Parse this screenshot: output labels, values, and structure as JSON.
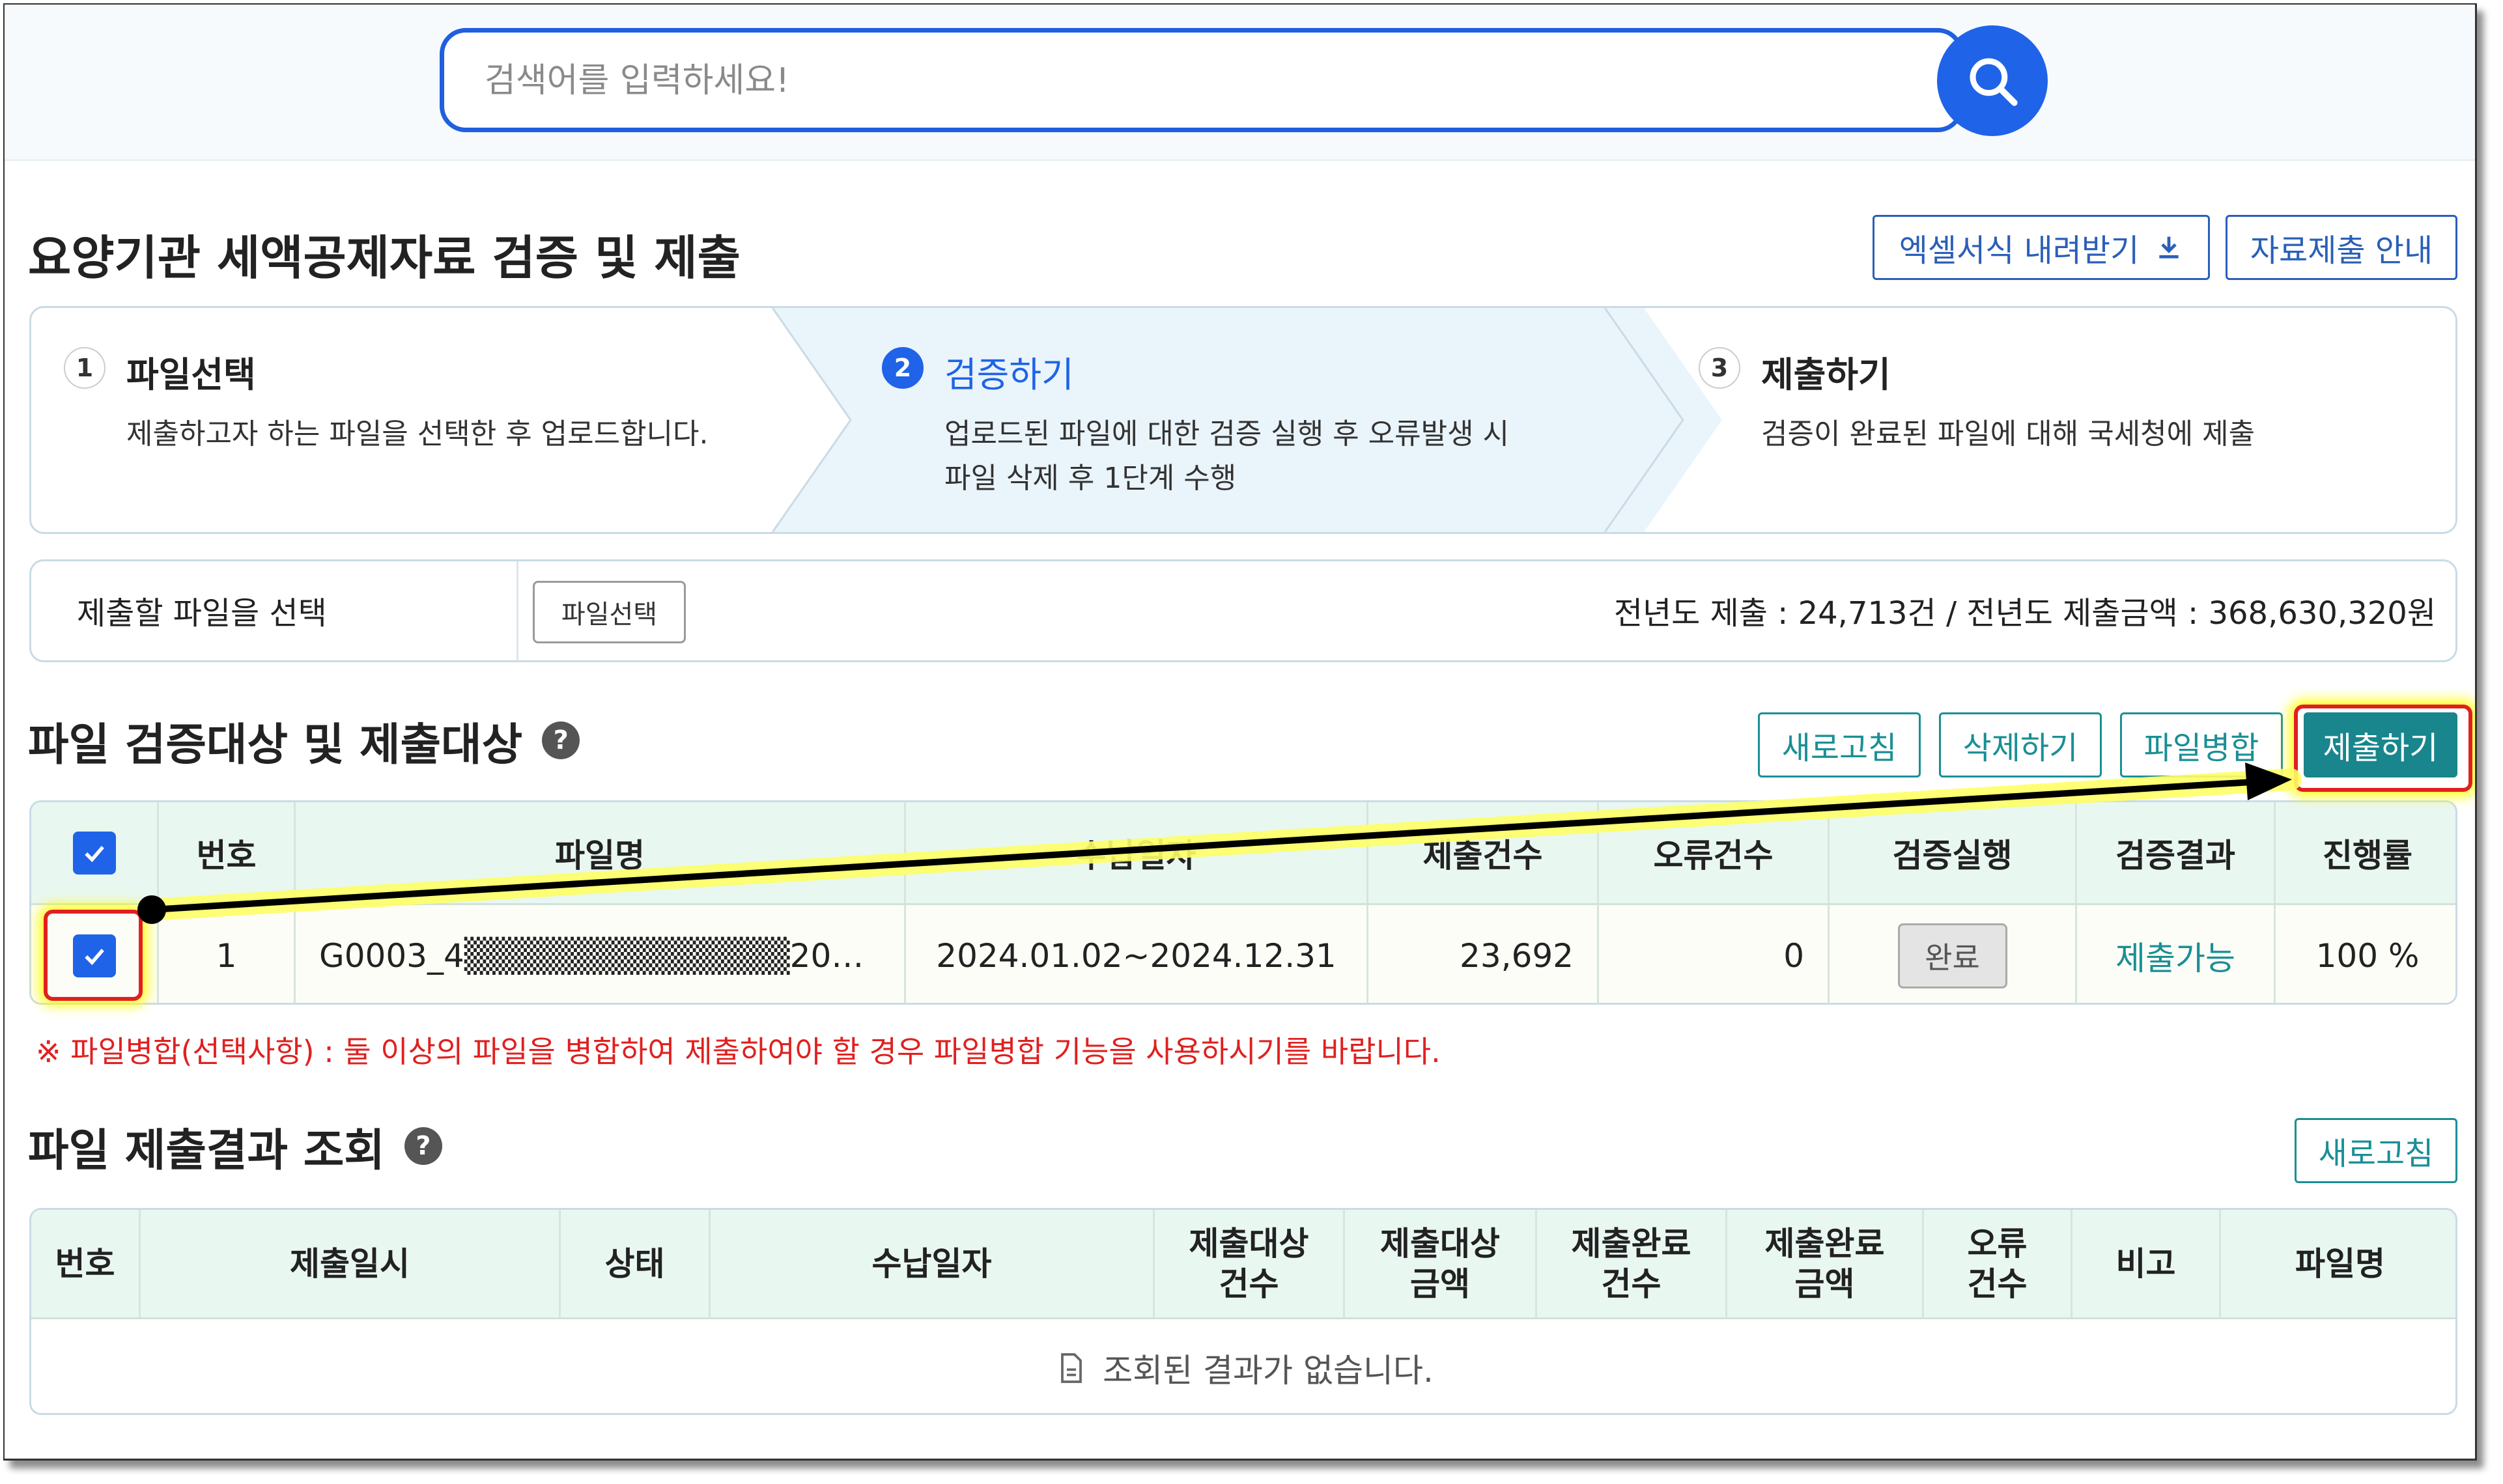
{
  "search": {
    "placeholder": "검색어를 입력하세요!"
  },
  "header": {
    "title": "요양기관 세액공제자료 검증 및 제출",
    "excel_download_label": "엑셀서식 내려받기",
    "guide_label": "자료제출 안내"
  },
  "steps": [
    {
      "num": "1",
      "title": "파일선택",
      "desc1": "제출하고자 하는 파일을 선택한 후 업로드합니다.",
      "desc2": ""
    },
    {
      "num": "2",
      "title": "검증하기",
      "desc1": "업로드된 파일에 대한 검증 실행 후 오류발생 시",
      "desc2": "파일 삭제 후 1단계 수행"
    },
    {
      "num": "3",
      "title": "제출하기",
      "desc1": "검증이 완료된 파일에 대해 국세청에 제출",
      "desc2": ""
    }
  ],
  "file_select": {
    "label": "제출할 파일을 선택",
    "button": "파일선택",
    "prev_year_summary": "전년도 제출 : 24,713건 / 전년도 제출금액 : 368,630,320원"
  },
  "verify_section": {
    "title": "파일 검증대상 및 제출대상",
    "buttons": {
      "refresh": "새로고침",
      "delete": "삭제하기",
      "merge": "파일병합",
      "submit": "제출하기"
    },
    "columns": [
      "번호",
      "파일명",
      "수납일자",
      "제출건수",
      "오류건수",
      "검증실행",
      "검증결과",
      "진행률"
    ],
    "rows": [
      {
        "no": "1",
        "filename": "G0003_4▒▒▒▒▒▒▒▒▒▒▒▒▒20…",
        "period": "2024.01.02~2024.12.31",
        "count": "23,692",
        "errors": "0",
        "run": "완료",
        "result": "제출가능",
        "progress": "100 %"
      }
    ],
    "notice": "※ 파일병합(선택사항) : 둘 이상의 파일을 병합하여 제출하여야 할 경우 파일병합 기능을 사용하시기를 바랍니다."
  },
  "result_section": {
    "title": "파일 제출결과 조회",
    "refresh": "새로고침",
    "columns": [
      {
        "l1": "번호",
        "l2": ""
      },
      {
        "l1": "제출일시",
        "l2": ""
      },
      {
        "l1": "상태",
        "l2": ""
      },
      {
        "l1": "수납일자",
        "l2": ""
      },
      {
        "l1": "제출대상",
        "l2": "건수"
      },
      {
        "l1": "제출대상",
        "l2": "금액"
      },
      {
        "l1": "제출완료",
        "l2": "건수"
      },
      {
        "l1": "제출완료",
        "l2": "금액"
      },
      {
        "l1": "오류",
        "l2": "건수"
      },
      {
        "l1": "비고",
        "l2": ""
      },
      {
        "l1": "파일명",
        "l2": ""
      }
    ],
    "empty_message": "조회된 결과가 없습니다."
  },
  "colors": {
    "primary": "#1f63e8",
    "teal": "#1a8f95",
    "error": "#e02020",
    "highlight": "#ffff00"
  }
}
